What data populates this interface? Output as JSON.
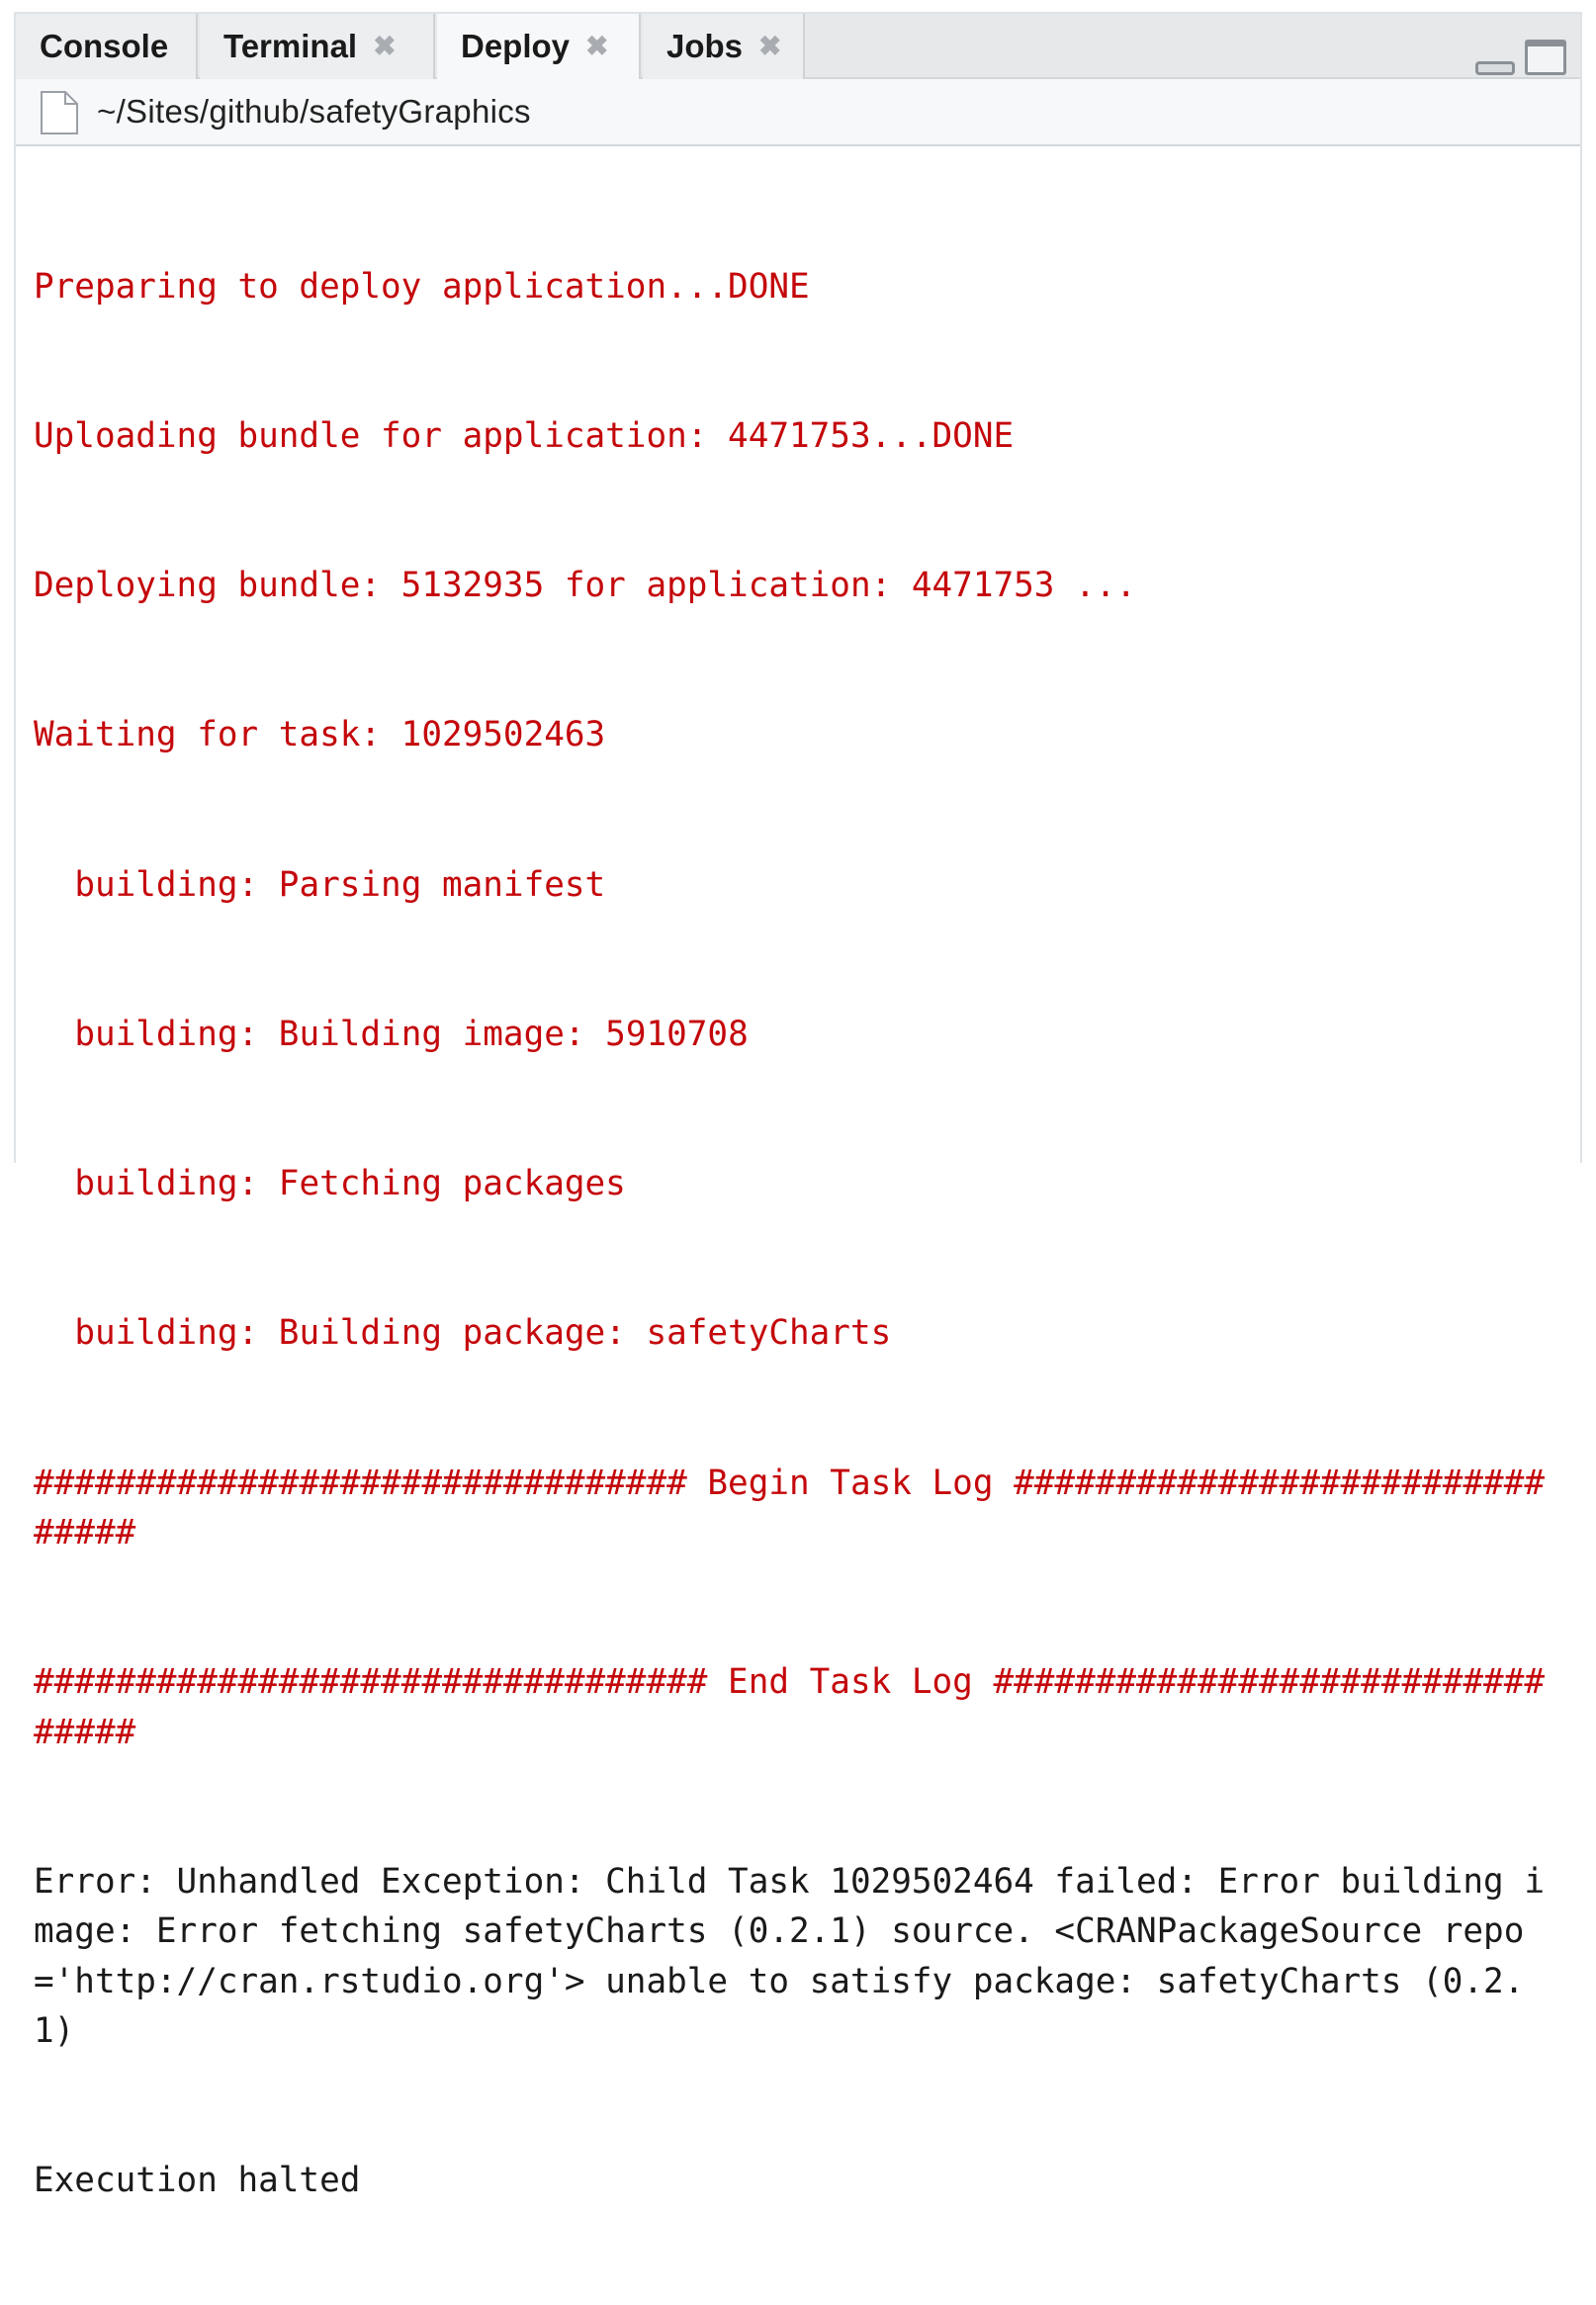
{
  "tabs": [
    {
      "label": "Console",
      "closable": false,
      "active": false
    },
    {
      "label": "Terminal",
      "closable": true,
      "active": false
    },
    {
      "label": "Deploy",
      "closable": true,
      "active": true
    },
    {
      "label": "Jobs",
      "closable": true,
      "active": false
    }
  ],
  "close_glyph": "✖",
  "path": "~/Sites/github/safetyGraphics",
  "output_lines": [
    {
      "text": "Preparing to deploy application...DONE",
      "color": "red"
    },
    {
      "text": "Uploading bundle for application: 4471753...DONE",
      "color": "red"
    },
    {
      "text": "Deploying bundle: 5132935 for application: 4471753 ...",
      "color": "red"
    },
    {
      "text": "Waiting for task: 1029502463",
      "color": "red"
    },
    {
      "text": "  building: Parsing manifest",
      "color": "red"
    },
    {
      "text": "  building: Building image: 5910708",
      "color": "red"
    },
    {
      "text": "  building: Fetching packages",
      "color": "red"
    },
    {
      "text": "  building: Building package: safetyCharts",
      "color": "red"
    },
    {
      "text": "################################ Begin Task Log ###############################",
      "color": "red"
    },
    {
      "text": "################################# End Task Log ################################",
      "color": "red"
    },
    {
      "text": "Error: Unhandled Exception: Child Task 1029502464 failed: Error building image: Error fetching safetyCharts (0.2.1) source. <CRANPackageSource repo='http://cran.rstudio.org'> unable to satisfy package: safetyCharts (0.2.1)",
      "color": "black"
    },
    {
      "text": "Execution halted",
      "color": "black"
    }
  ],
  "colors": {
    "stderr": "#c4070b",
    "stdout": "#1a1a1a",
    "tab_bar": "#e6e8ea",
    "active_tab": "#f7f8f9"
  }
}
